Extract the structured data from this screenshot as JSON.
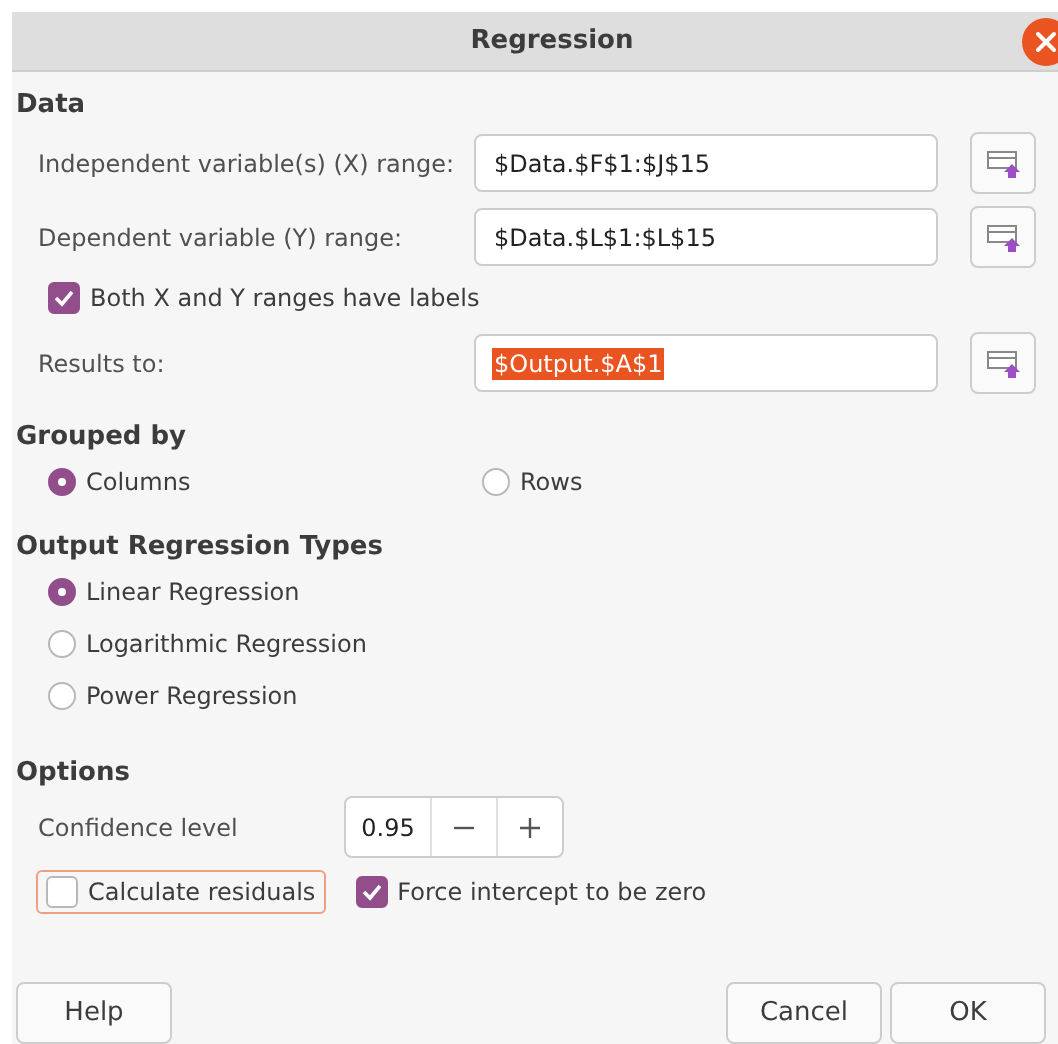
{
  "window": {
    "title": "Regression"
  },
  "data": {
    "heading": "Data",
    "ranges": [
      {
        "label": "Independent variable(s) (X) range:",
        "value": "$Data.$F$1:$J$15",
        "selected": false
      },
      {
        "label": "Dependent variable (Y) range:",
        "value": "$Data.$L$1:$L$15",
        "selected": false
      }
    ],
    "labels_checkbox": {
      "label": "Both X and Y ranges have labels",
      "checked": true
    },
    "results": {
      "label": "Results to:",
      "value": "$Output.$A$1",
      "selected": true
    }
  },
  "grouped_by": {
    "heading": "Grouped by",
    "options": [
      {
        "label": "Columns",
        "selected": true
      },
      {
        "label": "Rows",
        "selected": false
      }
    ]
  },
  "regression_types": {
    "heading": "Output Regression Types",
    "options": [
      {
        "label": "Linear Regression",
        "selected": true
      },
      {
        "label": "Logarithmic Regression",
        "selected": false
      },
      {
        "label": "Power Regression",
        "selected": false
      }
    ]
  },
  "options": {
    "heading": "Options",
    "confidence_label": "Confidence level",
    "confidence_value": "0.95",
    "checkboxes": [
      {
        "label": "Calculate residuals",
        "checked": false,
        "focused": true
      },
      {
        "label": "Force intercept to be zero",
        "checked": true,
        "focused": false
      }
    ]
  },
  "buttons": {
    "help": "Help",
    "cancel": "Cancel",
    "ok": "OK"
  }
}
